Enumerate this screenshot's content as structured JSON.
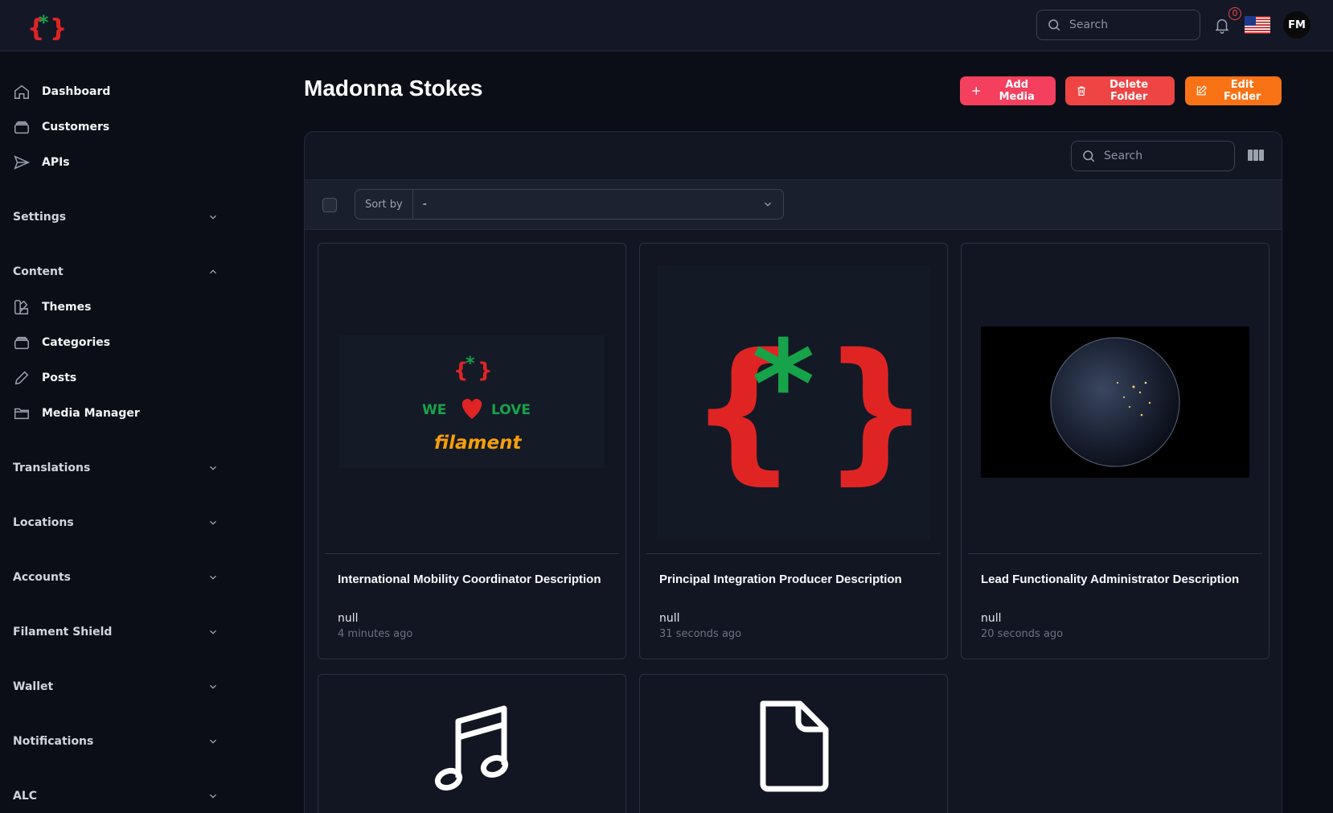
{
  "topbar": {
    "search_placeholder": "Search",
    "notification_count": "0",
    "user_initials": "FM"
  },
  "sidebar": {
    "items": [
      {
        "label": "Dashboard",
        "icon": "home-icon"
      },
      {
        "label": "Customers",
        "icon": "stack-icon"
      },
      {
        "label": "APIs",
        "icon": "send-icon"
      }
    ],
    "content_items": [
      {
        "label": "Themes",
        "icon": "swatch-icon"
      },
      {
        "label": "Categories",
        "icon": "stack-icon"
      },
      {
        "label": "Posts",
        "icon": "pencil-icon"
      },
      {
        "label": "Media Manager",
        "icon": "folder-icon"
      }
    ],
    "groups": {
      "settings": "Settings",
      "content": "Content",
      "translations": "Translations",
      "locations": "Locations",
      "accounts": "Accounts",
      "filament_shield": "Filament Shield",
      "wallet": "Wallet",
      "notifications": "Notifications",
      "alc": "ALC"
    }
  },
  "page": {
    "title": "Madonna Stokes",
    "add_media": "Add Media",
    "delete_folder": "Delete Folder",
    "edit_folder": "Edit Folder"
  },
  "grid": {
    "search_placeholder": "Search",
    "sort_by_label": "Sort by",
    "sort_by_value": "-"
  },
  "cards": [
    {
      "title": "International Mobility Coordinator Description",
      "description": "null",
      "time": "4 minutes ago",
      "media": {
        "we": "WE",
        "love": "LOVE",
        "brand": "filament"
      }
    },
    {
      "title": "Principal Integration Producer Description",
      "description": "null",
      "time": "31 seconds ago"
    },
    {
      "title": "Lead Functionality Administrator Description",
      "description": "null",
      "time": "20 seconds ago"
    },
    {
      "media_icon": "music-note-icon"
    },
    {
      "media_icon": "document-icon"
    }
  ],
  "colors": {
    "brand_red": "#e02424",
    "brand_green": "#16a34a",
    "add_button": "#f43f5e",
    "delete_button": "#ef4444",
    "edit_button": "#f97316"
  }
}
